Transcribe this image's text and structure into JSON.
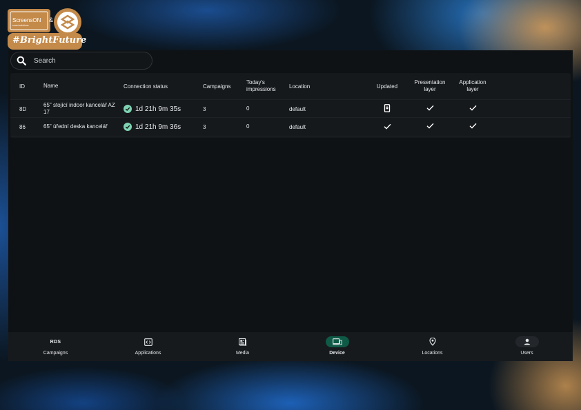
{
  "brand": {
    "logo_text": "ScreensON",
    "logo_subtext": "smart solutions",
    "amp": "&",
    "hashtag": "#BrightFuture"
  },
  "search": {
    "placeholder": "Search",
    "value": ""
  },
  "table": {
    "headers": {
      "id": "ID",
      "name": "Name",
      "connection": "Connection status",
      "campaigns": "Campaigns",
      "impressions": "Today's impressions",
      "location": "Location",
      "updated": "Updated",
      "presentation": "Presentation layer",
      "application": "Application layer"
    },
    "rows": [
      {
        "id": "8D",
        "name": "65\" stojící indoor kancelář AZ 17",
        "connection": "1d 21h 9m 35s",
        "campaigns": "3",
        "impressions": "0",
        "location": "default",
        "updated_icon": "phone-update-icon",
        "presentation_icon": "check-icon",
        "application_icon": "check-icon"
      },
      {
        "id": "86",
        "name": "65\" úřední deska kancelář",
        "connection": "1d 21h 9m 36s",
        "campaigns": "3",
        "impressions": "0",
        "location": "default",
        "updated_icon": "check-icon",
        "presentation_icon": "check-icon",
        "application_icon": "check-icon"
      }
    ]
  },
  "nav": {
    "campaigns": {
      "label": "Campaigns",
      "icon_text": "RDS"
    },
    "applications": {
      "label": "Applications",
      "icon": "code-window-icon"
    },
    "media": {
      "label": "Media",
      "icon": "media-icon"
    },
    "device": {
      "label": "Device",
      "icon": "devices-icon",
      "active": true
    },
    "locations": {
      "label": "Locations",
      "icon": "location-pin-icon"
    },
    "users": {
      "label": "Users",
      "icon": "person-icon"
    }
  },
  "colors": {
    "active_pill": "#0e5a46",
    "status_ok": "#7fd3b2",
    "panel_bg": "#0f1215"
  }
}
